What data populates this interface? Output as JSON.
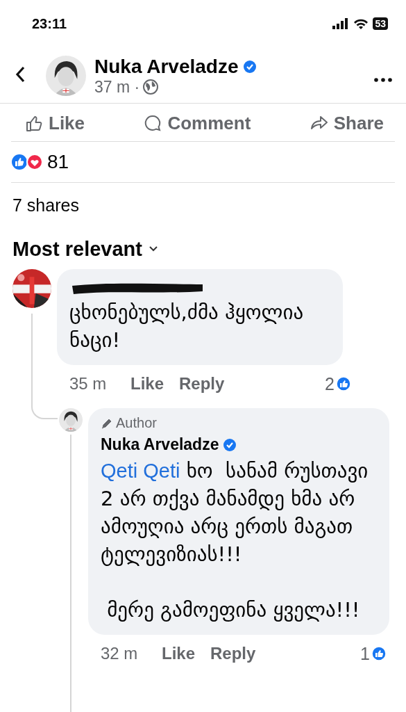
{
  "status_bar": {
    "time": "23:11",
    "battery": "53"
  },
  "post": {
    "author": "Nuka Arveladze",
    "verified": true,
    "time": "37 m ·"
  },
  "actions": [
    {
      "kind": "like",
      "label": "Like"
    },
    {
      "kind": "comment",
      "label": "Comment"
    },
    {
      "kind": "share",
      "label": "Share"
    }
  ],
  "reactions": {
    "count": "81"
  },
  "shares": "7 shares",
  "sort": "Most relevant",
  "comments": [
    {
      "author_redacted": true,
      "text": "ცხონებულს,ძმა ჰყოლია ნაცი!",
      "time": "35 m",
      "like": "Like",
      "reply": "Reply",
      "likes": "2",
      "replies": [
        {
          "badge": "Author",
          "author": "Nuka Arveladze",
          "verified": true,
          "mention": "Qeti Qeti",
          "text": "ხო  სანამ რუსთავი 2 არ თქვა მანამდე ხმა არ ამოუღია არც ერთს მაგათ ტელევიზიას!!!\n\n მერე გამოეფინა ყველა!!!",
          "time": "32 m",
          "like": "Like",
          "reply": "Reply",
          "likes": "1"
        }
      ]
    }
  ]
}
